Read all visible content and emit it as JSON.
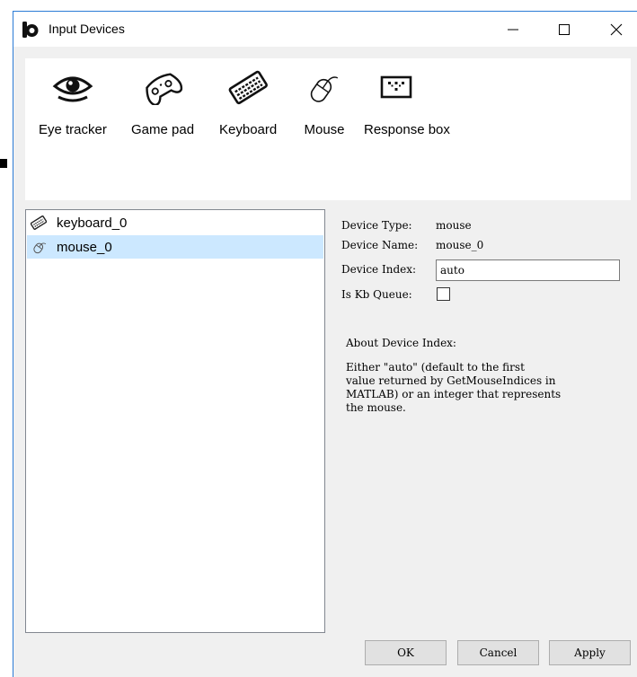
{
  "window": {
    "title": "Input Devices"
  },
  "toolbar": {
    "items": [
      {
        "label": "Eye tracker",
        "icon": "eye-icon"
      },
      {
        "label": "Game pad",
        "icon": "gamepad-icon"
      },
      {
        "label": "Keyboard",
        "icon": "keyboard-icon"
      },
      {
        "label": "Mouse",
        "icon": "mouse-icon"
      },
      {
        "label": "Response box",
        "icon": "response-box-icon"
      }
    ]
  },
  "devices": [
    {
      "name": "keyboard_0",
      "icon": "keyboard-icon",
      "selected": false
    },
    {
      "name": "mouse_0",
      "icon": "mouse-icon",
      "selected": true
    }
  ],
  "properties": {
    "type_label": "Device Type:",
    "type_value": "mouse",
    "name_label": "Device Name:",
    "name_value": "mouse_0",
    "index_label": "Device Index:",
    "index_value": "auto",
    "kbqueue_label": "Is Kb Queue:",
    "kbqueue_checked": false
  },
  "about": {
    "title": "About Device Index:",
    "body": "Either \"auto\" (default to the first\nvalue returned by GetMouseIndices in\nMATLAB) or an integer that represents\nthe mouse."
  },
  "buttons": {
    "ok": "OK",
    "cancel": "Cancel",
    "apply": "Apply"
  },
  "colors": {
    "selection": "#cce8ff",
    "window_border": "#2b7bd6"
  }
}
